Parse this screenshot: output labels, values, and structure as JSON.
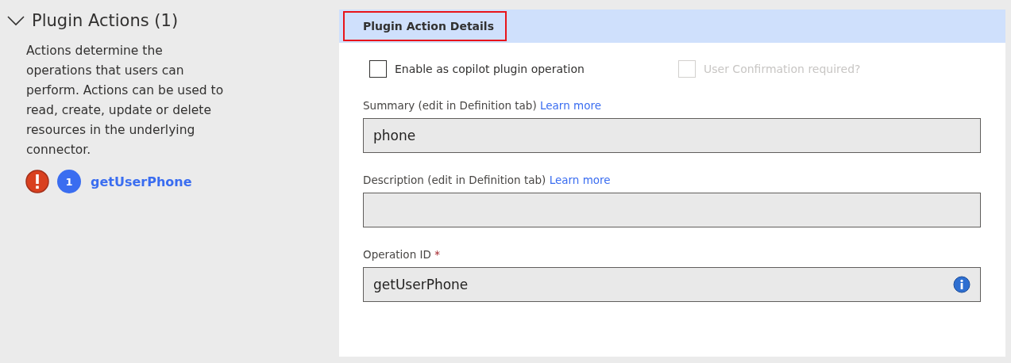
{
  "section": {
    "title": "Plugin Actions (1)",
    "expanded": true,
    "description": "Actions determine the operations that users can perform. Actions can be used to read, create, update or delete resources in the underlying connector.",
    "actions": [
      {
        "error": true,
        "number": "1",
        "name": "getUserPhone"
      }
    ]
  },
  "details": {
    "title": "Plugin Action Details",
    "highlighted": true,
    "checkboxes": [
      {
        "label": "Enable as copilot plugin operation",
        "checked": false,
        "disabled": false
      },
      {
        "label": "User Confirmation required?",
        "checked": false,
        "disabled": true
      }
    ],
    "fields": [
      {
        "label": "Summary (edit in Definition tab)",
        "link": "Learn more",
        "value": "phone"
      },
      {
        "label": "Description (edit in Definition tab)",
        "link": "Learn more"
      },
      {
        "label": "Operation ID",
        "required_mark": "*",
        "value": "getUserPhone",
        "info": true
      }
    ]
  }
}
